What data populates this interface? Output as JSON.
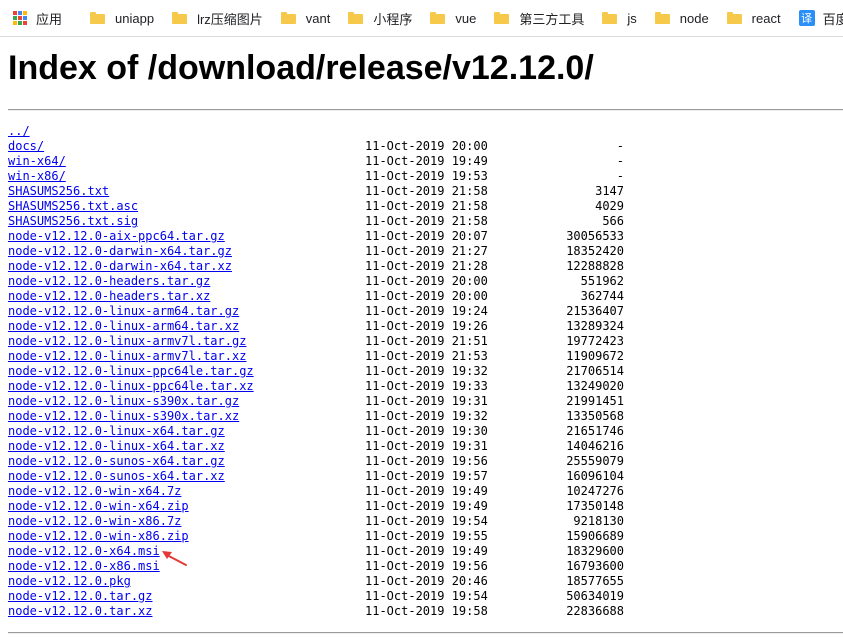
{
  "bookmarks": {
    "apps_label": "应用",
    "items": [
      "uniapp",
      "lrz压缩图片",
      "vant",
      "小程序",
      "vue",
      "第三方工具",
      "js",
      "node",
      "react"
    ],
    "translate_label": "百度翻译",
    "translate_icon_glyph": "译"
  },
  "page": {
    "title": "Index of /download/release/v12.12.0/"
  },
  "listing": [
    {
      "name": "../",
      "date": "",
      "size": ""
    },
    {
      "name": "docs/",
      "date": "11-Oct-2019 20:00",
      "size": "-"
    },
    {
      "name": "win-x64/",
      "date": "11-Oct-2019 19:49",
      "size": "-"
    },
    {
      "name": "win-x86/",
      "date": "11-Oct-2019 19:53",
      "size": "-"
    },
    {
      "name": "SHASUMS256.txt",
      "date": "11-Oct-2019 21:58",
      "size": "3147"
    },
    {
      "name": "SHASUMS256.txt.asc",
      "date": "11-Oct-2019 21:58",
      "size": "4029"
    },
    {
      "name": "SHASUMS256.txt.sig",
      "date": "11-Oct-2019 21:58",
      "size": "566"
    },
    {
      "name": "node-v12.12.0-aix-ppc64.tar.gz",
      "date": "11-Oct-2019 20:07",
      "size": "30056533"
    },
    {
      "name": "node-v12.12.0-darwin-x64.tar.gz",
      "date": "11-Oct-2019 21:27",
      "size": "18352420"
    },
    {
      "name": "node-v12.12.0-darwin-x64.tar.xz",
      "date": "11-Oct-2019 21:28",
      "size": "12288828"
    },
    {
      "name": "node-v12.12.0-headers.tar.gz",
      "date": "11-Oct-2019 20:00",
      "size": "551962"
    },
    {
      "name": "node-v12.12.0-headers.tar.xz",
      "date": "11-Oct-2019 20:00",
      "size": "362744"
    },
    {
      "name": "node-v12.12.0-linux-arm64.tar.gz",
      "date": "11-Oct-2019 19:24",
      "size": "21536407"
    },
    {
      "name": "node-v12.12.0-linux-arm64.tar.xz",
      "date": "11-Oct-2019 19:26",
      "size": "13289324"
    },
    {
      "name": "node-v12.12.0-linux-armv7l.tar.gz",
      "date": "11-Oct-2019 21:51",
      "size": "19772423"
    },
    {
      "name": "node-v12.12.0-linux-armv7l.tar.xz",
      "date": "11-Oct-2019 21:53",
      "size": "11909672"
    },
    {
      "name": "node-v12.12.0-linux-ppc64le.tar.gz",
      "date": "11-Oct-2019 19:32",
      "size": "21706514"
    },
    {
      "name": "node-v12.12.0-linux-ppc64le.tar.xz",
      "date": "11-Oct-2019 19:33",
      "size": "13249020"
    },
    {
      "name": "node-v12.12.0-linux-s390x.tar.gz",
      "date": "11-Oct-2019 19:31",
      "size": "21991451"
    },
    {
      "name": "node-v12.12.0-linux-s390x.tar.xz",
      "date": "11-Oct-2019 19:32",
      "size": "13350568"
    },
    {
      "name": "node-v12.12.0-linux-x64.tar.gz",
      "date": "11-Oct-2019 19:30",
      "size": "21651746"
    },
    {
      "name": "node-v12.12.0-linux-x64.tar.xz",
      "date": "11-Oct-2019 19:31",
      "size": "14046216"
    },
    {
      "name": "node-v12.12.0-sunos-x64.tar.gz",
      "date": "11-Oct-2019 19:56",
      "size": "25559079"
    },
    {
      "name": "node-v12.12.0-sunos-x64.tar.xz",
      "date": "11-Oct-2019 19:57",
      "size": "16096104"
    },
    {
      "name": "node-v12.12.0-win-x64.7z",
      "date": "11-Oct-2019 19:49",
      "size": "10247276"
    },
    {
      "name": "node-v12.12.0-win-x64.zip",
      "date": "11-Oct-2019 19:49",
      "size": "17350148"
    },
    {
      "name": "node-v12.12.0-win-x86.7z",
      "date": "11-Oct-2019 19:54",
      "size": "9218130"
    },
    {
      "name": "node-v12.12.0-win-x86.zip",
      "date": "11-Oct-2019 19:55",
      "size": "15906689"
    },
    {
      "name": "node-v12.12.0-x64.msi",
      "date": "11-Oct-2019 19:49",
      "size": "18329600"
    },
    {
      "name": "node-v12.12.0-x86.msi",
      "date": "11-Oct-2019 19:56",
      "size": "16793600"
    },
    {
      "name": "node-v12.12.0.pkg",
      "date": "11-Oct-2019 20:46",
      "size": "18577655"
    },
    {
      "name": "node-v12.12.0.tar.gz",
      "date": "11-Oct-2019 19:54",
      "size": "50634019"
    },
    {
      "name": "node-v12.12.0.tar.xz",
      "date": "11-Oct-2019 19:58",
      "size": "22836688"
    }
  ],
  "colors": {
    "link": "#0000ee",
    "annotation_arrow": "#e53935",
    "folder": "#f6c94a"
  },
  "icons": {
    "apps": "apps-grid-icon",
    "folder": "folder-icon",
    "translate": "translate-icon",
    "arrow": "red-arrow-annotation"
  }
}
